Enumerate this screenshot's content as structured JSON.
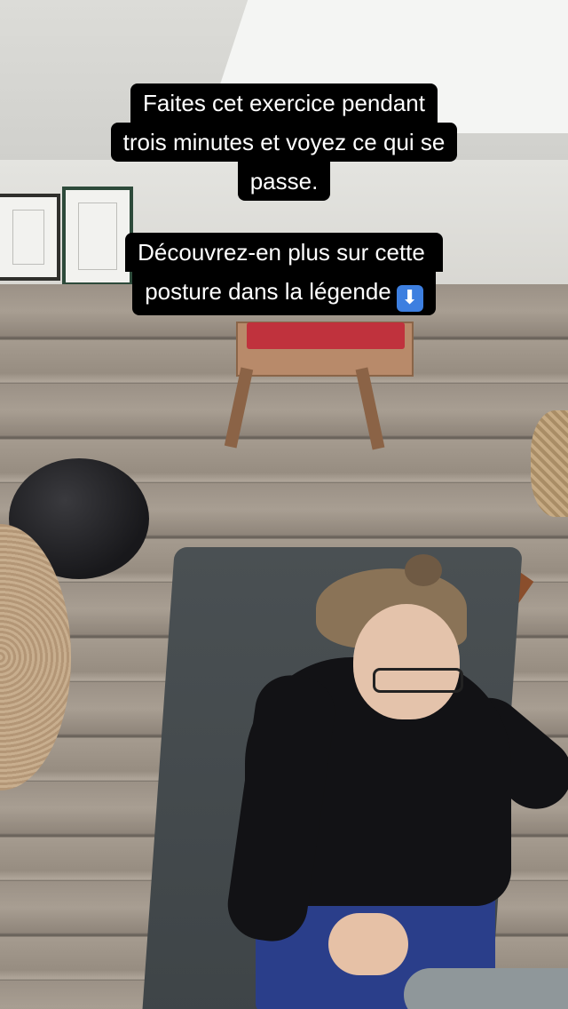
{
  "caption_1": {
    "lines": [
      "Faites cet exercice pendant",
      "trois minutes et voyez ce qui se",
      "passe."
    ]
  },
  "caption_2": {
    "lines": [
      "Découvrez-en plus sur cette",
      "posture dans la légende"
    ],
    "emoji": "⬇",
    "emoji_icon": "down-arrow-emoji-icon"
  },
  "colors": {
    "caption_bg": "#000000",
    "caption_text": "#ffffff",
    "emoji_bg": "#3d7fe0"
  }
}
